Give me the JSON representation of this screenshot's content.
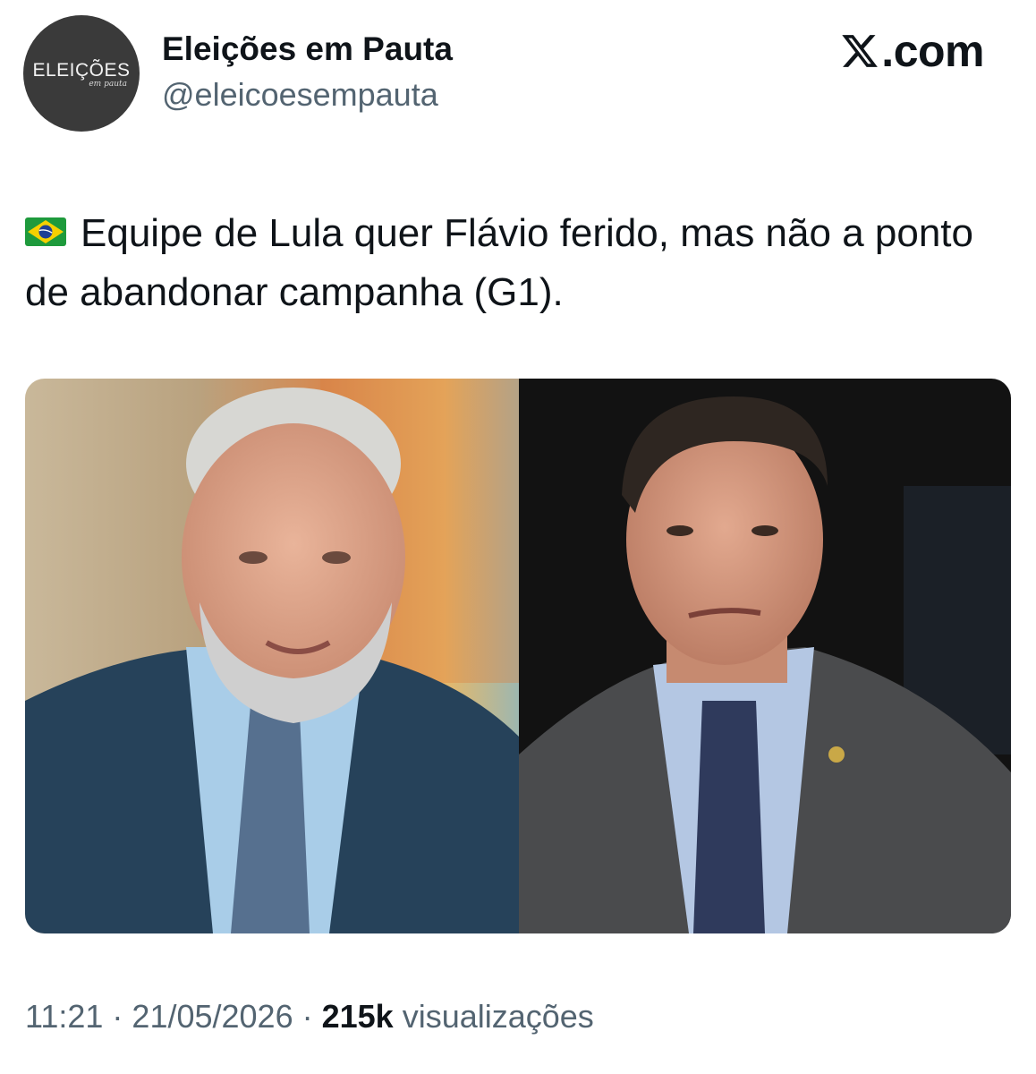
{
  "author": {
    "avatar_text": "ELEIÇÕES",
    "avatar_subtext": "em pauta",
    "display_name": "Eleições em Pauta",
    "handle": "@eleicoesempauta"
  },
  "brand": {
    "icon": "x-logo-icon",
    "text": ".com"
  },
  "tweet": {
    "flag_icon": "brazil-flag-icon",
    "text": "Equipe de Lula quer Flávio ferido, mas não a ponto de abandonar campanha (G1)."
  },
  "media": {
    "photos": [
      {
        "description_icon": "photo-left"
      },
      {
        "description_icon": "photo-right"
      }
    ]
  },
  "meta": {
    "time": "11:21",
    "separator": " · ",
    "date": "21/05/2026",
    "views_count": "215k",
    "views_label": " visualizações"
  },
  "colors": {
    "text_primary": "#0f1419",
    "text_secondary": "#536471",
    "avatar_bg": "#3a3a3a"
  }
}
